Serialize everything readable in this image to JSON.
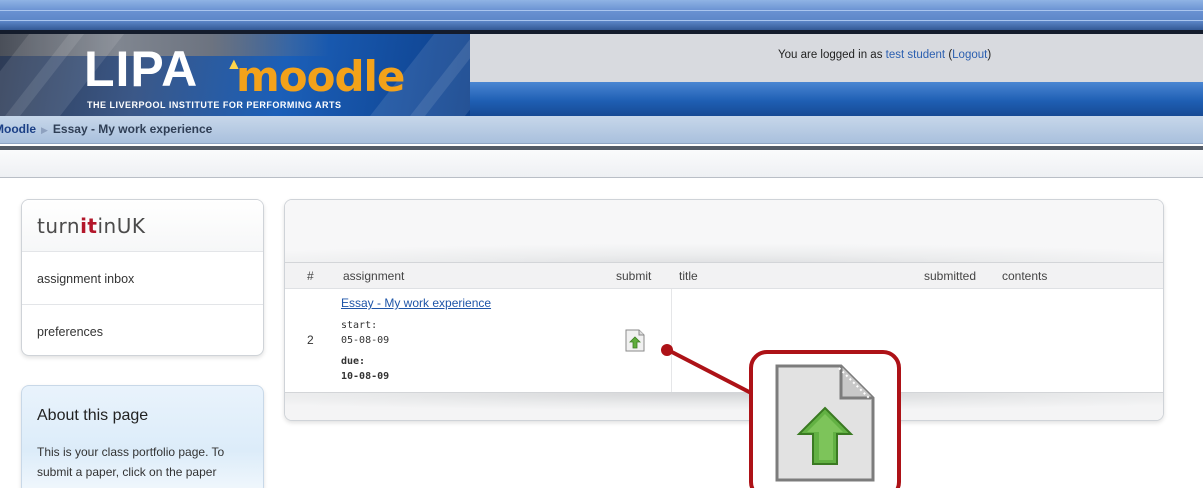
{
  "header": {
    "logged_in_prefix": "You are logged in as",
    "user_name": "test student",
    "logout_label": "Logout",
    "logo_main": "LIPA",
    "logo_moodle": "moodle",
    "logo_tagline": "THE LIVERPOOL INSTITUTE FOR PERFORMING ARTS"
  },
  "breadcrumb": {
    "root": "Moodle",
    "current": "Essay - My work experience"
  },
  "sidebar": {
    "brand_pre": "turn",
    "brand_it": "it",
    "brand_post": "inUK",
    "items": [
      {
        "label": "assignment inbox"
      },
      {
        "label": "preferences"
      }
    ],
    "about_title": "About this page",
    "about_text": "This is your class portfolio page. To submit a paper, click on the paper"
  },
  "table": {
    "columns": {
      "num": "#",
      "assignment": "assignment",
      "submit": "submit",
      "title": "title",
      "submitted": "submitted",
      "contents": "contents"
    },
    "row": {
      "num": "2",
      "title": "Essay - My work experience",
      "start_label": "start:",
      "start_date": "05-08-09",
      "due_label": "due:",
      "due_date": "10-08-09"
    }
  },
  "icons": {
    "submit": "submit-paper-icon",
    "highlight": "submit-paper-zoom-icon"
  },
  "colors": {
    "callout": "#ad1217",
    "link": "#1e55a8",
    "header_blue": "#1f5fb4",
    "moodle_orange": "#f3a21a"
  }
}
